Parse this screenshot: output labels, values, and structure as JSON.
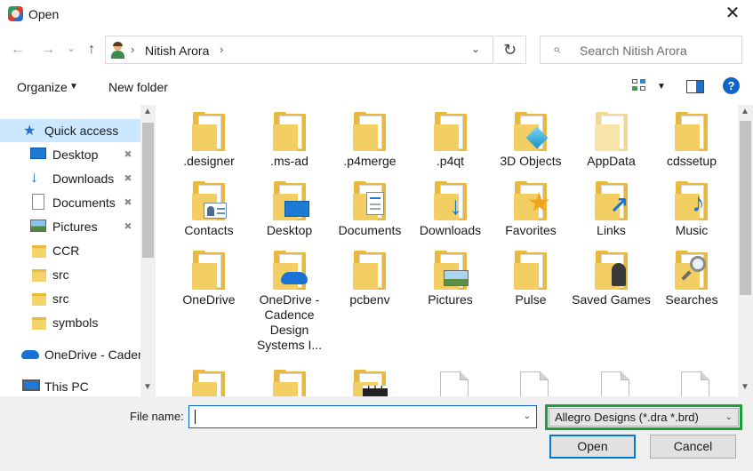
{
  "window": {
    "title": "Open",
    "close_glyph": "✕"
  },
  "nav": {
    "back_glyph": "←",
    "forward_glyph": "→",
    "recent_glyph": "⌄",
    "up_glyph": "↑",
    "address": {
      "path": "Nitish Arora",
      "sep": "›"
    },
    "refresh_glyph": "↻",
    "search_placeholder": "Search Nitish Arora",
    "search_glyph": "⌕"
  },
  "toolbar": {
    "organize_label": "Organize",
    "new_folder_label": "New folder",
    "help_glyph": "?"
  },
  "sidebar": {
    "items": [
      {
        "label": "Quick access",
        "icon": "star-icon",
        "pinned": false
      },
      {
        "label": "Desktop",
        "icon": "desktop-icon",
        "pinned": true
      },
      {
        "label": "Downloads",
        "icon": "download-icon",
        "pinned": true
      },
      {
        "label": "Documents",
        "icon": "documents-icon",
        "pinned": true
      },
      {
        "label": "Pictures",
        "icon": "pictures-icon",
        "pinned": true
      },
      {
        "label": "CCR",
        "icon": "folder-icon",
        "pinned": false
      },
      {
        "label": "src",
        "icon": "folder-icon",
        "pinned": false
      },
      {
        "label": "src",
        "icon": "folder-icon",
        "pinned": false
      },
      {
        "label": "symbols",
        "icon": "folder-icon",
        "pinned": false
      },
      {
        "label": "OneDrive - Caden",
        "icon": "cloud-icon",
        "pinned": false
      },
      {
        "label": "This PC",
        "icon": "pc-icon",
        "pinned": false
      }
    ],
    "pin_glyph": "📌"
  },
  "files": [
    {
      "label": ".designer",
      "type": "folder"
    },
    {
      "label": ".ms-ad",
      "type": "folder"
    },
    {
      "label": ".p4merge",
      "type": "folder"
    },
    {
      "label": ".p4qt",
      "type": "folder"
    },
    {
      "label": "3D Objects",
      "type": "folder-3d"
    },
    {
      "label": "AppData",
      "type": "folder-faded"
    },
    {
      "label": "cdssetup",
      "type": "folder"
    },
    {
      "label": "Contacts",
      "type": "folder-contacts"
    },
    {
      "label": "Desktop",
      "type": "folder-desktop"
    },
    {
      "label": "Documents",
      "type": "folder-documents"
    },
    {
      "label": "Downloads",
      "type": "folder-downloads"
    },
    {
      "label": "Favorites",
      "type": "folder-favorites"
    },
    {
      "label": "Links",
      "type": "folder-links"
    },
    {
      "label": "Music",
      "type": "folder-music"
    },
    {
      "label": "OneDrive",
      "type": "folder"
    },
    {
      "label": "OneDrive - Cadence Design Systems I...",
      "type": "folder-onedrive"
    },
    {
      "label": "pcbenv",
      "type": "folder"
    },
    {
      "label": "Pictures",
      "type": "folder-pictures"
    },
    {
      "label": "Pulse",
      "type": "folder"
    },
    {
      "label": "Saved Games",
      "type": "folder-games"
    },
    {
      "label": "Searches",
      "type": "folder-searches"
    },
    {
      "label": "",
      "type": "folder"
    },
    {
      "label": "",
      "type": "folder"
    },
    {
      "label": "",
      "type": "folder-video"
    },
    {
      "label": "",
      "type": "file"
    },
    {
      "label": "",
      "type": "file"
    },
    {
      "label": "",
      "type": "file"
    },
    {
      "label": "",
      "type": "file"
    }
  ],
  "bottom": {
    "file_name_label": "File name:",
    "file_name_value": "",
    "file_type": "Allegro Designs (*.dra *.brd)",
    "open_label": "Open",
    "cancel_label": "Cancel",
    "dropdown_glyph": "⌄"
  },
  "colors": {
    "highlight_box": "#1a9e3a",
    "selection": "#cce8ff",
    "accent": "#0078d7"
  }
}
